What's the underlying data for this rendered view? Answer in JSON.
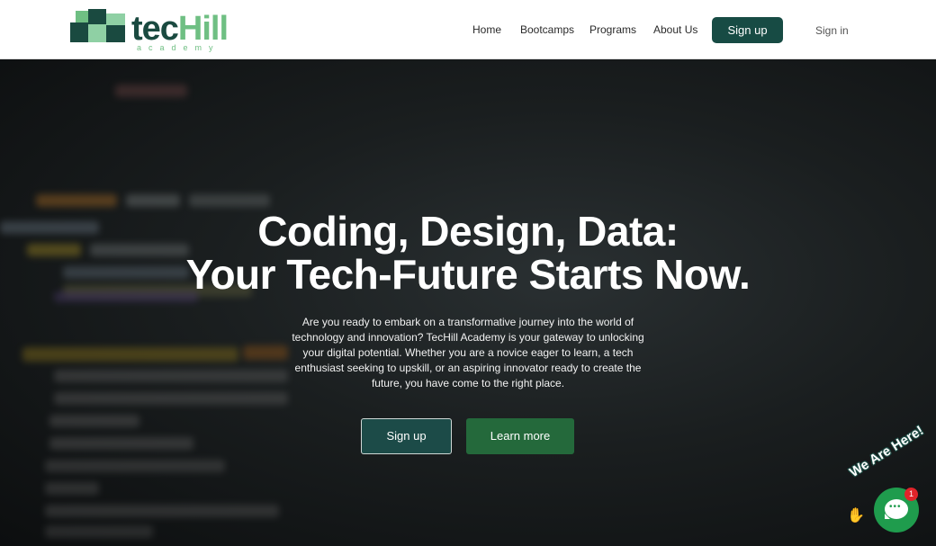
{
  "brand": {
    "name_part1": "tec",
    "name_part2": "Hill",
    "tagline": "academy",
    "colors": {
      "dark": "#1a4a40",
      "light": "#6fbf83"
    }
  },
  "nav": {
    "items": [
      {
        "label": "Home"
      },
      {
        "label": "Bootcamps"
      },
      {
        "label": "Programs"
      },
      {
        "label": "About Us"
      }
    ],
    "signup_label": "Sign up",
    "signin_label": "Sign in"
  },
  "hero": {
    "title_line1": "Coding, Design, Data:",
    "title_line2": "Your Tech-Future Starts Now.",
    "description": "Are you ready to embark on a transformative journey into the world of technology and innovation? TecHill Academy is your gateway to unlocking your digital potential. Whether you are a novice eager to learn, a tech enthusiast seeking to upskill, or an aspiring innovator ready to create the future, you have come to the right place.",
    "primary_button": "Sign up",
    "secondary_button": "Learn more"
  },
  "chat_widget": {
    "label": "We Are Here!",
    "wave_icon": "waving-hand-icon",
    "chat_icon": "chat-bubble-icon",
    "unread_count": "1",
    "color": "#1f9c4d"
  }
}
